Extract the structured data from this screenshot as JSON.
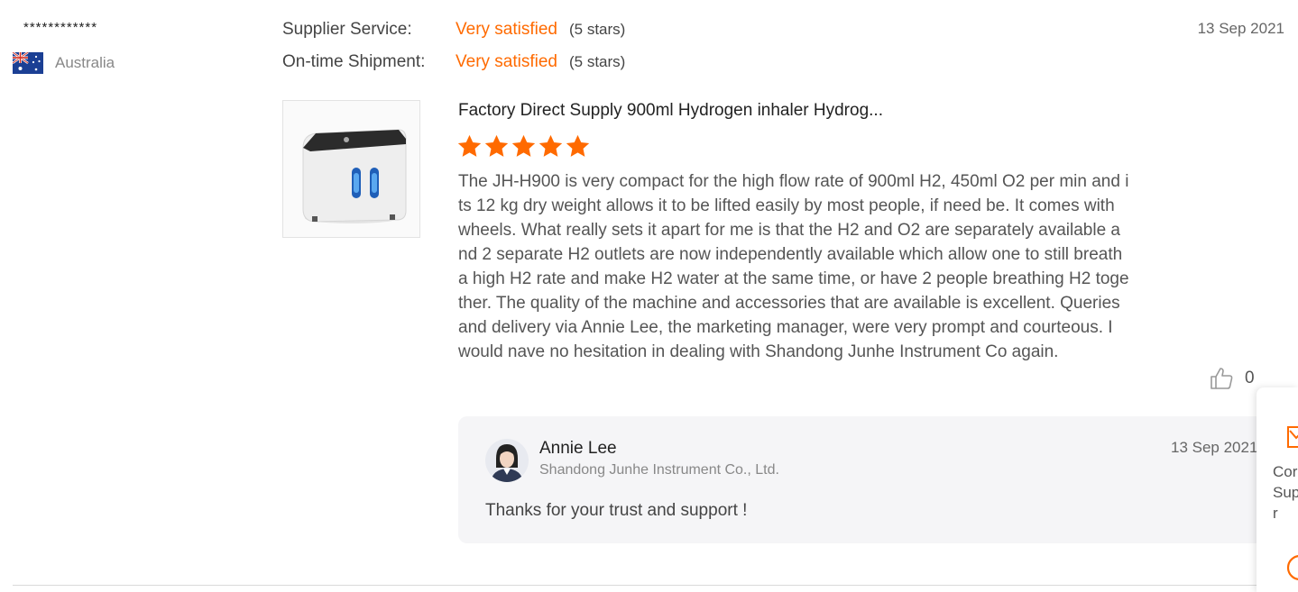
{
  "reviewer": {
    "name": "************",
    "country": "Australia",
    "flag_icon": "australia-flag-icon"
  },
  "ratings": [
    {
      "label": "Supplier Service:",
      "value": "Very satisfied",
      "stars": "(5 stars)"
    },
    {
      "label": "On-time Shipment:",
      "value": "Very satisfied",
      "stars": "(5 stars)"
    }
  ],
  "review": {
    "date": "13 Sep 2021",
    "product_title": "Factory Direct Supply 900ml Hydrogen inhaler Hydrog...",
    "star_count": 5,
    "star_icon": "star-icon",
    "body": "The JH-H900 is very compact for the high flow rate of 900ml H2, 450ml O2 per min and its 12 kg dry weight allows it to be lifted easily by most people, if need be. It comes with wheels. What really sets it apart for me is that the H2 and O2 are separately available and 2 separate H2 outlets are now independently available which allow one to still breath a high H2 rate and make H2 water at the same time, or have 2 people breathing H2 together. The quality of the machine and accessories that are available is excellent. Queries and delivery via Annie Lee, the marketing manager, were very prompt and courteous. I would nave no hesitation in dealing with Shandong Junhe Instrument Co again.",
    "likes": "0",
    "like_icon": "thumbs-up-icon"
  },
  "reply": {
    "name": "Annie Lee",
    "company": "Shandong Junhe Instrument Co., Ltd.",
    "date": "13 Sep 2021",
    "text": "Thanks for your trust and support !"
  },
  "side_panel": {
    "label": "Cor\nSup\nr"
  },
  "colors": {
    "accent": "#ff6a00",
    "reply_bg": "#f5f5f7"
  }
}
